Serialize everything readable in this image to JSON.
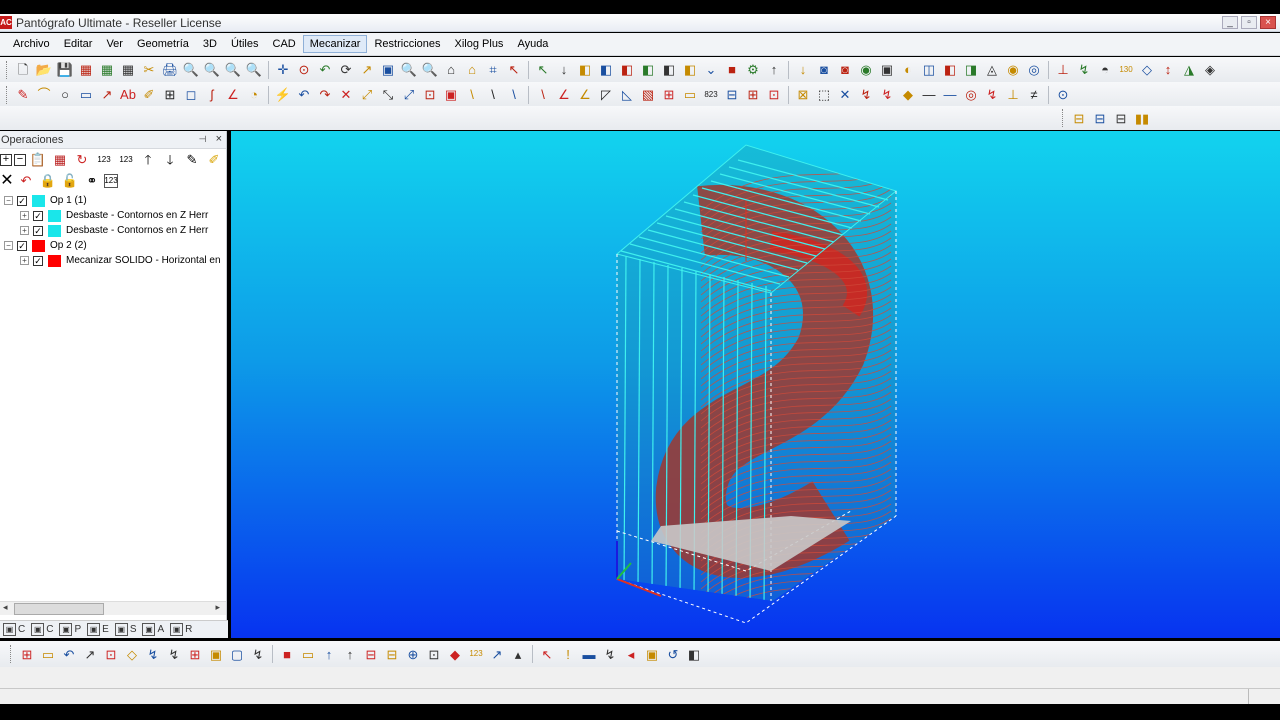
{
  "window": {
    "title": "Pantógrafo Ultimate - Reseller License",
    "app_icon": "AC",
    "minimize": "_",
    "maximize": "▫",
    "close": "×"
  },
  "menu": [
    "Archivo",
    "Editar",
    "Ver",
    "Geometría",
    "3D",
    "Útiles",
    "CAD",
    "Mecanizar",
    "Restricciones",
    "Xilog Plus",
    "Ayuda"
  ],
  "toolbar1_icons": [
    "🗋",
    "📂",
    "💾",
    "▦",
    "▦",
    "▦",
    "✂",
    "🖨",
    "🔍",
    "🔍",
    "🔍",
    "🔍",
    "✛",
    "⊙",
    "↶",
    "⟳",
    "↗",
    "▣",
    "🔍",
    "🔍",
    "⌂",
    "⌂",
    "⌗",
    "↖",
    "↖",
    "↓",
    "◧",
    "◧",
    "◧",
    "◧",
    "◧",
    "◧",
    "⌄",
    "■",
    "⚙",
    "↑",
    "↓",
    "◙",
    "◙",
    "◉",
    "▣",
    "◐",
    "◫",
    "◧",
    "◨",
    "◬",
    "◉",
    "◎",
    "⊥",
    "↯",
    "◓",
    "130",
    "◇",
    "↕",
    "◮",
    "◈"
  ],
  "toolbar2_icons": [
    "✎",
    "⌒",
    "○",
    "▭",
    "↗",
    "Ab",
    "✐",
    "⊞",
    "◻",
    "ʃ",
    "∠",
    "◔",
    "⚡",
    "↶",
    "↷",
    "✕",
    "⤢",
    "⤡",
    "⤢",
    "⊡",
    "▣",
    "\\",
    "\\",
    "\\",
    "\\",
    "∠",
    "∠",
    "◸",
    "◺",
    "▧",
    "⊞",
    "▭",
    "823",
    "⊟",
    "⊞",
    "⊡",
    "⊠",
    "⬚",
    "✕",
    "↯",
    "↯",
    "◆",
    "—",
    "—",
    "◎",
    "↯",
    "⊥",
    "≠",
    "⊙"
  ],
  "toolbar3_icons": [
    "⊟",
    "⊟",
    "⊟",
    "▮▮"
  ],
  "ops": {
    "title": "Operaciones",
    "pin": "📌",
    "close": "×",
    "tree": [
      {
        "level": 0,
        "label": "Op 1  (1)",
        "color": "#1ae6ea",
        "expanded": true
      },
      {
        "level": 1,
        "label": "Desbaste - Contornos en Z   Herr",
        "color": "#1ae6ea"
      },
      {
        "level": 1,
        "label": "Desbaste - Contornos en Z   Herr",
        "color": "#1ae6ea"
      },
      {
        "level": 0,
        "label": "Op 2  (2)",
        "color": "#ff0000",
        "expanded": true
      },
      {
        "level": 1,
        "label": "Mecanizar SOLIDO - Horizontal en",
        "color": "#ff0000"
      }
    ],
    "bottom_tabs": [
      "C",
      "C",
      "P",
      "E",
      "S",
      "A",
      "R"
    ]
  },
  "bottom_toolbar_icons": [
    "⊞",
    "▭",
    "↶",
    "↗",
    "⊡",
    "◇",
    "↯",
    "↯",
    "⊞",
    "▣",
    "▢",
    "↯",
    "■",
    "▭",
    "↑",
    "↑",
    "⊟",
    "⊟",
    "⊕",
    "⊡",
    "◆",
    "123",
    "↗",
    "▴",
    "↖",
    "!",
    "▬",
    "↯",
    "◂",
    "▣",
    "↺",
    "◧"
  ],
  "colors": {
    "accent_cyan": "#1ae6ea",
    "accent_red": "#ff0000",
    "viewport_top": "#12d3ee",
    "viewport_bottom": "#0733f0"
  }
}
